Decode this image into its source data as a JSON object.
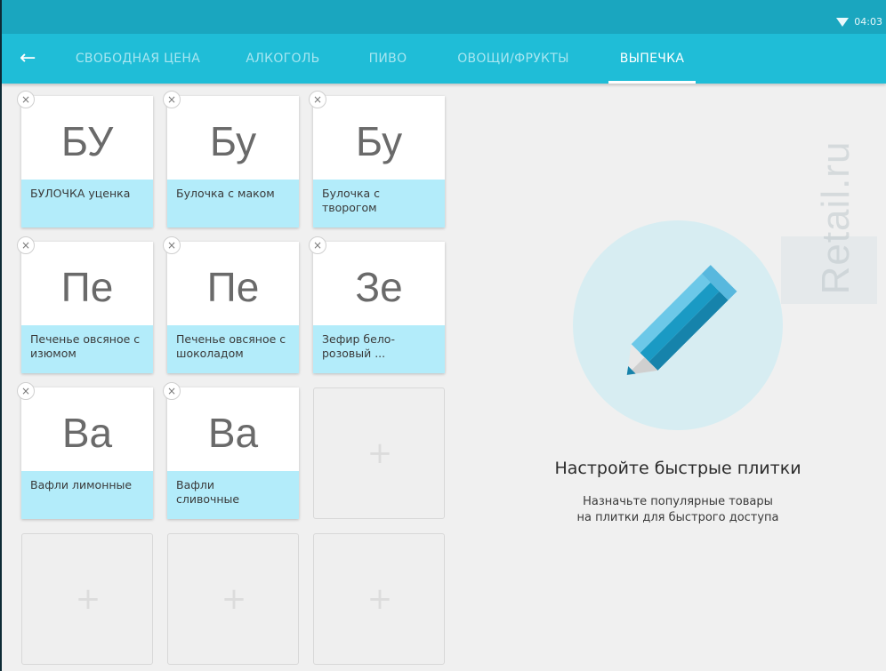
{
  "status_bar": {
    "time": "04:03",
    "wifi_icon": "wifi-icon"
  },
  "toolbar": {
    "back_icon": "arrow-left-icon",
    "tabs": [
      {
        "label": "СВОБОДНАЯ ЦЕНА",
        "active": false
      },
      {
        "label": "АЛКОГОЛЬ",
        "active": false
      },
      {
        "label": "ПИВО",
        "active": false
      },
      {
        "label": "ОВОЩИ/ФРУКТЫ",
        "active": false
      },
      {
        "label": "ВЫПЕЧКА",
        "active": true
      }
    ]
  },
  "tiles": [
    {
      "abbr": "БУ",
      "label": "БУЛОЧКА уценка"
    },
    {
      "abbr": "Бу",
      "label": "Булочка с маком"
    },
    {
      "abbr": "Бу",
      "label": "Булочка с творогом"
    },
    {
      "abbr": "Пе",
      "label": "Печенье овсяное с изюмом"
    },
    {
      "abbr": "Пе",
      "label": "Печенье овсяное с шоколадом"
    },
    {
      "abbr": "Зе",
      "label": "Зефир бело-розовый ..."
    },
    {
      "abbr": "Ва",
      "label": "Вафли лимонные"
    },
    {
      "abbr": "Ва",
      "label": "Вафли сливочные"
    }
  ],
  "remove_glyph": "×",
  "add_glyph": "+",
  "empty_state": {
    "icon": "pencil-icon",
    "title": "Настройте быстрые плитки",
    "subtitle_line1": "Назначьте популярные товары",
    "subtitle_line2": "на плитки для быстрого доступа"
  },
  "watermark": {
    "text": "Retail.ru"
  },
  "colors": {
    "status_bar": "#1aa6bf",
    "toolbar": "#1fbdd7",
    "tile_label_bg": "#b3ecfa",
    "pencil_blue": "#1a9ac4"
  }
}
